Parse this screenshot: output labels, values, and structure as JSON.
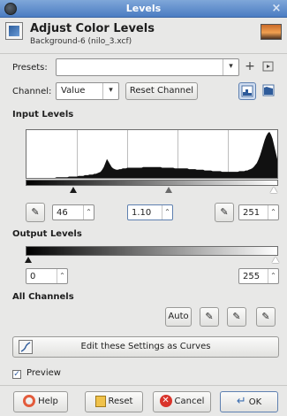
{
  "window": {
    "title": "Levels",
    "close_glyph": "×"
  },
  "header": {
    "title": "Adjust Color Levels",
    "subtitle": "Background-6 (nilo_3.xcf)"
  },
  "presets": {
    "label": "Presets:",
    "value": "",
    "add_icon": "plus-icon",
    "menu_icon": "menu-icon"
  },
  "channel": {
    "label": "Channel:",
    "value": "Value",
    "reset_label": "Reset Channel"
  },
  "input_levels": {
    "heading": "Input Levels",
    "low": "46",
    "gamma": "1.10",
    "high": "251",
    "histogram": [
      0,
      0,
      0,
      0,
      0,
      0,
      0,
      0,
      0,
      0,
      0,
      0,
      0,
      0,
      0,
      0,
      0,
      0,
      0,
      1,
      1,
      1,
      1,
      1,
      1,
      1,
      1,
      2,
      2,
      2,
      2,
      2,
      2,
      3,
      3,
      3,
      3,
      4,
      4,
      4,
      5,
      5,
      5,
      6,
      6,
      7,
      8,
      9,
      12,
      16,
      22,
      28,
      24,
      20,
      16,
      14,
      13,
      12,
      12,
      13,
      13,
      14,
      14,
      14,
      15,
      15,
      15,
      15,
      15,
      15,
      15,
      15,
      15,
      15,
      16,
      16,
      16,
      16,
      16,
      16,
      16,
      16,
      16,
      16,
      16,
      16,
      15,
      15,
      15,
      15,
      15,
      15,
      15,
      15,
      14,
      14,
      14,
      14,
      14,
      14,
      14,
      14,
      14,
      13,
      13,
      13,
      13,
      13,
      12,
      12,
      12,
      12,
      12,
      11,
      11,
      11,
      11,
      11,
      10,
      10,
      10,
      10,
      10,
      10,
      9,
      9,
      9,
      9,
      9,
      9,
      9,
      9,
      9,
      9,
      9,
      10,
      10,
      10,
      10,
      11,
      11,
      12,
      13,
      14,
      16,
      19,
      22,
      27,
      33,
      40,
      48,
      56,
      62,
      66,
      68,
      64,
      58,
      48,
      38,
      28
    ]
  },
  "output_levels": {
    "heading": "Output Levels",
    "low": "0",
    "high": "255"
  },
  "all_channels": {
    "heading": "All Channels",
    "auto_label": "Auto"
  },
  "curves_button": {
    "label": "Edit these Settings as Curves"
  },
  "preview": {
    "label": "Preview",
    "checked": true
  },
  "footer": {
    "help": "Help",
    "reset": "Reset",
    "cancel": "Cancel",
    "ok": "OK"
  },
  "colors": {
    "titlebar": "#5a88c8",
    "cancel_icon": "#d9342b",
    "help_icon": "#e35c3c"
  }
}
